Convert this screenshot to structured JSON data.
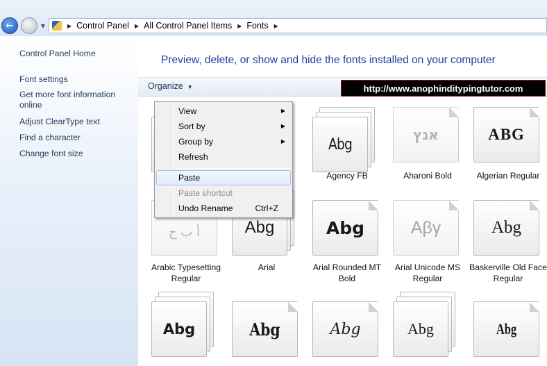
{
  "address_bar": {
    "back": "back-arrow-icon",
    "forward": "forward-arrow-icon",
    "breadcrumbs": [
      "Control Panel",
      "All Control Panel Items",
      "Fonts"
    ]
  },
  "sidebar": {
    "home": "Control Panel Home",
    "links": [
      "Font settings",
      "Get more font information online",
      "Adjust ClearType text",
      "Find a character",
      "Change font size"
    ]
  },
  "main": {
    "heading": "Preview, delete, or show and hide the fonts installed on your computer",
    "organize_label": "Organize",
    "banner": "http://www.anophinditypingtutor.com"
  },
  "context_menu": {
    "items": [
      {
        "label": "View",
        "submenu": true
      },
      {
        "label": "Sort by",
        "submenu": true
      },
      {
        "label": "Group by",
        "submenu": true
      },
      {
        "label": "Refresh"
      },
      {
        "label": "Paste",
        "highlighted": true
      },
      {
        "label": "Paste shortcut",
        "disabled": true
      },
      {
        "label": "Undo Rename",
        "shortcut": "Ctrl+Z"
      }
    ]
  },
  "fonts": [
    {
      "name": "Agency FB",
      "sample": "Abg"
    },
    {
      "name": "Aharoni Bold",
      "sample": "אגץ"
    },
    {
      "name": "Algerian Regular",
      "sample": "ABG"
    },
    {
      "name": "Arabic Typesetting Regular",
      "sample": "أ ب ج"
    },
    {
      "name": "Arial",
      "sample": "Abg"
    },
    {
      "name": "Arial Rounded MT Bold",
      "sample": "Abg"
    },
    {
      "name": "Arial Unicode MS Regular",
      "sample": "Αβγ"
    },
    {
      "name": "Baskerville Old Face Regular",
      "sample": "Abg"
    },
    {
      "name": "",
      "sample": "Abg"
    },
    {
      "name": "",
      "sample": "Abg"
    },
    {
      "name": "",
      "sample": "Abg"
    },
    {
      "name": "",
      "sample": "Abg"
    },
    {
      "name": "",
      "sample": "Abg"
    }
  ]
}
